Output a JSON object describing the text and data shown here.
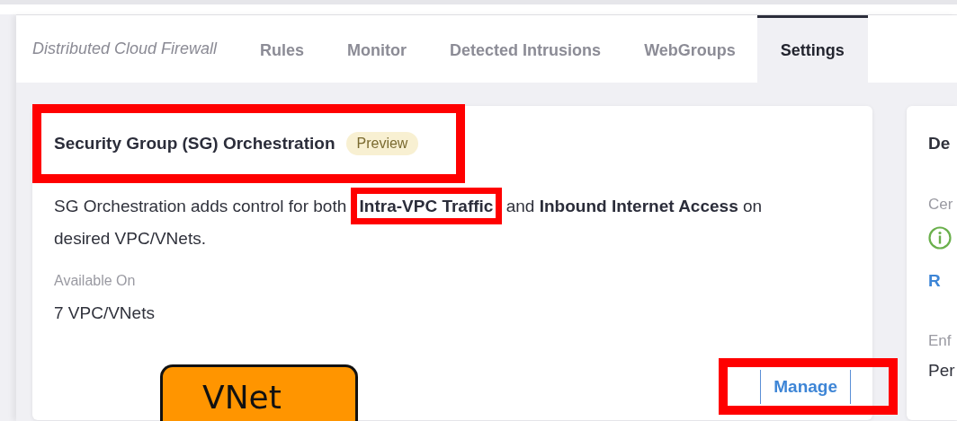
{
  "tabs": [
    {
      "label": "Distributed Cloud Firewall",
      "kind": "title"
    },
    {
      "label": "Rules",
      "kind": "tab",
      "selected": false
    },
    {
      "label": "Monitor",
      "kind": "tab",
      "selected": false
    },
    {
      "label": "Detected Intrusions",
      "kind": "tab",
      "selected": false
    },
    {
      "label": "WebGroups",
      "kind": "tab",
      "selected": false
    },
    {
      "label": "Settings",
      "kind": "tab",
      "selected": true
    }
  ],
  "sg_card": {
    "title": "Security Group (SG) Orchestration",
    "badge": "Preview",
    "description": "SG Orchestration adds control for both **Intra-VPC Traffic** and **Inbound Internet Access** on desired VPC/VNets.",
    "available_label": "Available On",
    "available_value": "7 VPC/VNets",
    "button": "Manage"
  },
  "side_card": {
    "title": "De",
    "label_1": "Cer",
    "link": "R",
    "label_2": "Enf",
    "value_2": "Per"
  },
  "annotations": [
    {
      "kind": "box"
    },
    {
      "kind": "box"
    },
    {
      "kind": "box"
    },
    {
      "kind": "callout",
      "text": "VNet"
    }
  ]
}
